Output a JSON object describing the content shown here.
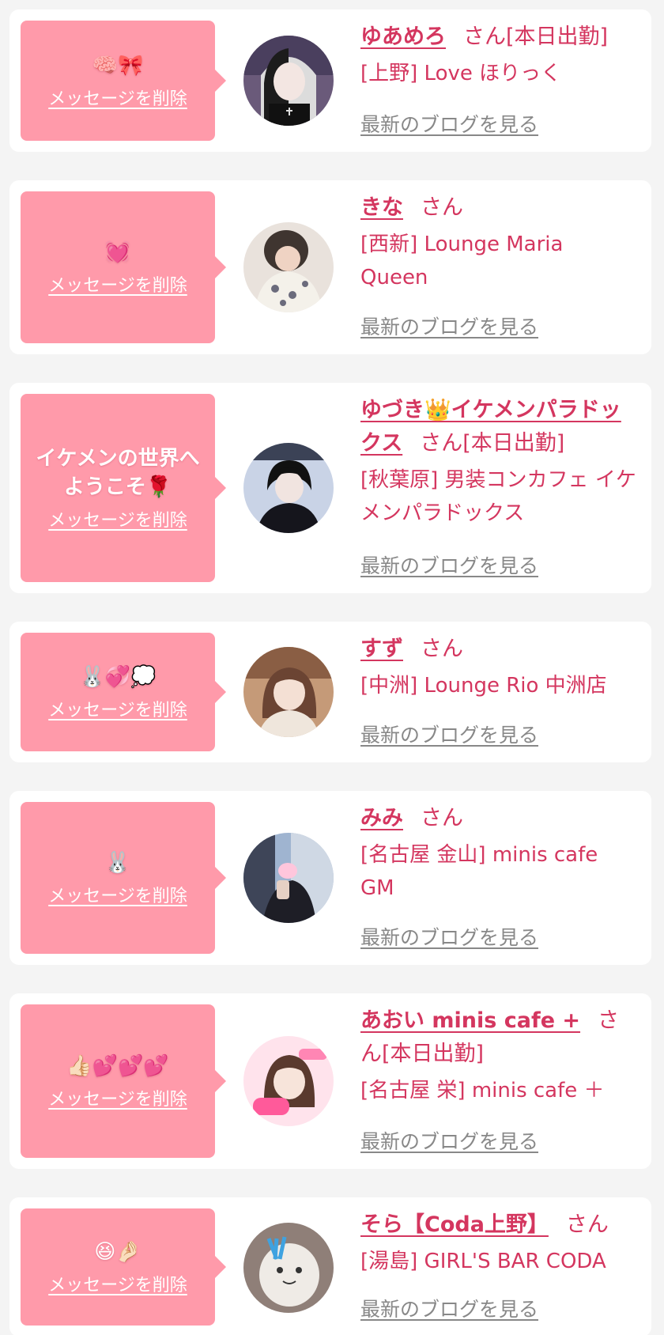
{
  "delete_label": "メッセージを削除",
  "blog_label": "最新のブログを見る",
  "colors": {
    "accent": "#d4365f",
    "bubble": "#ff9aaa",
    "card": "#ffffff",
    "page_bg": "#f4f4f4",
    "link_gray": "#888888"
  },
  "messages": [
    {
      "message": "🧠🎀",
      "name": "ゆあめろ",
      "suffix": "さん[本日出勤]",
      "area": "[上野] Love ほりっく",
      "avatar_icon": "portrait-goth-twintail"
    },
    {
      "message": "💓",
      "name": "きな",
      "suffix": "さん",
      "area": "[西新] Lounge Maria Queen",
      "avatar_icon": "portrait-floral-dress"
    },
    {
      "message": "イケメンの世界へようこそ🌹",
      "name": "ゆづき👑イケメンパラドックス",
      "suffix": "さん[本日出勤]",
      "area": "[秋葉原] 男装コンカフェ イケメンパラドックス",
      "avatar_icon": "portrait-black-hair"
    },
    {
      "message": "🐰💞💭",
      "name": "すず",
      "suffix": "さん",
      "area": "[中洲] Lounge Rio 中洲店",
      "avatar_icon": "portrait-brown-hair"
    },
    {
      "message": "🐰",
      "name": "みみ",
      "suffix": "さん",
      "area": "[名古屋 金山] minis cafe GM",
      "avatar_icon": "portrait-mirror-selfie"
    },
    {
      "message": "👍🏻💕💕💕",
      "name": "あおい minis cafe +",
      "suffix": "さん[本日出勤]",
      "area": "[名古屋 栄] minis cafe ＋",
      "avatar_icon": "portrait-sticker-frame"
    },
    {
      "message": "😆🤌🏻",
      "name": "そら【Coda上野】",
      "suffix": "さん",
      "area": "[湯島] GIRL'S BAR CODA",
      "avatar_icon": "portrait-plush-toy"
    }
  ]
}
